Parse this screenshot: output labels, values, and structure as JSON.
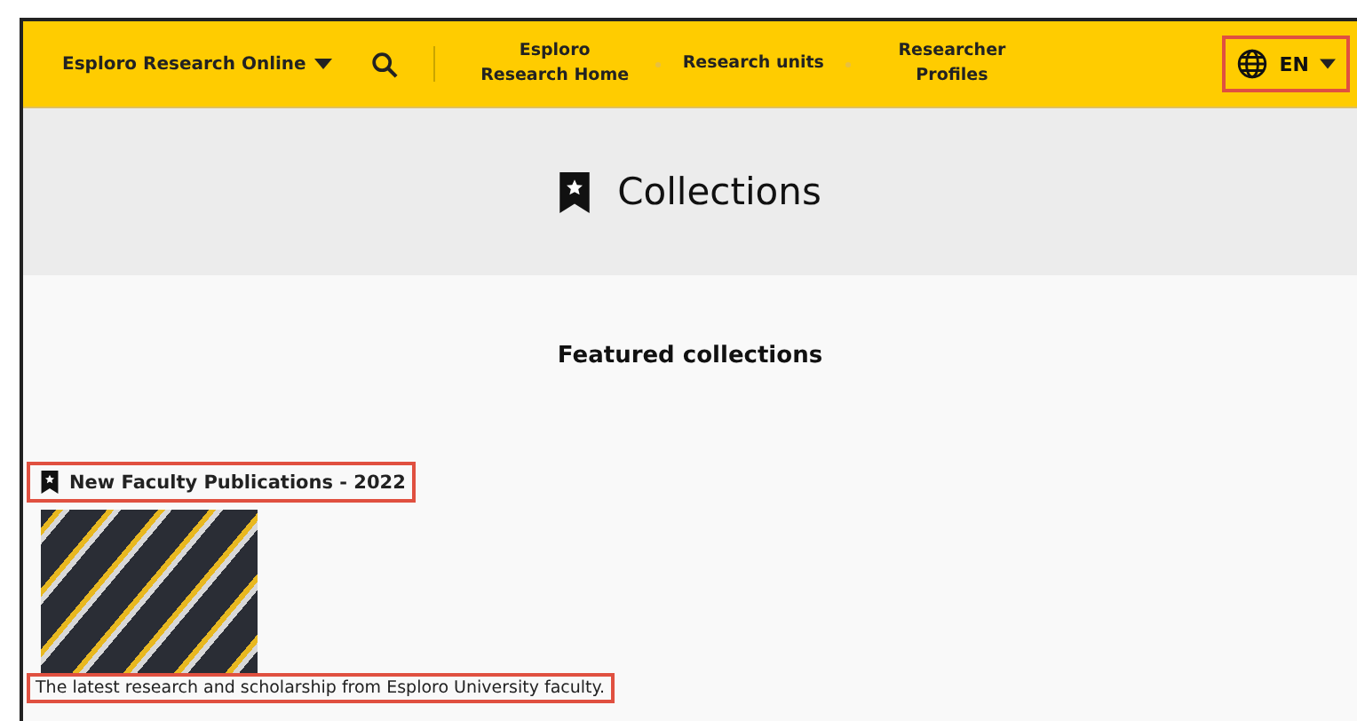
{
  "header": {
    "brand": "Esploro Research Online",
    "nav": [
      {
        "label": "Esploro Research Home"
      },
      {
        "label": "Research units"
      },
      {
        "label": "Researcher Profiles"
      }
    ],
    "language": "EN",
    "language_highlighted": true
  },
  "banner": {
    "title": "Collections"
  },
  "featured": {
    "heading": "Featured collections",
    "collections": [
      {
        "title": "New Faculty Publications - 2022",
        "description": "The latest research and scholarship from Esploro University faculty.",
        "highlighted": true
      }
    ]
  }
}
